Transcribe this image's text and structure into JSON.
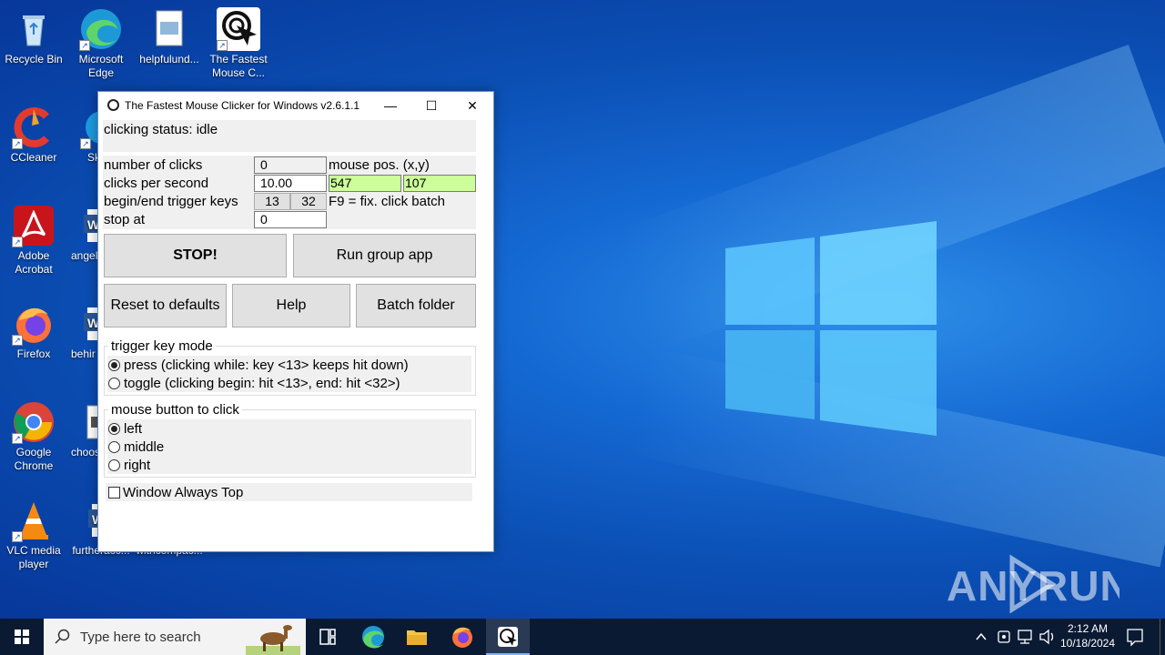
{
  "desktop": {
    "icons": [
      {
        "label": "Recycle Bin",
        "icon": "recycle-bin-icon"
      },
      {
        "label": "Microsoft Edge",
        "icon": "edge-icon"
      },
      {
        "label": "helpfulund...",
        "icon": "image-file-icon"
      },
      {
        "label": "The Fastest Mouse C...",
        "icon": "mouse-clicker-icon"
      },
      {
        "label": "CCleaner",
        "icon": "ccleaner-icon"
      },
      {
        "label": "Sk",
        "icon": "skype-icon"
      },
      {
        "label": "Adobe Acrobat",
        "icon": "acrobat-icon"
      },
      {
        "label": "angel",
        "icon": "word-doc-icon"
      },
      {
        "label": "Firefox",
        "icon": "firefox-icon"
      },
      {
        "label": "behir",
        "icon": "word-doc-icon"
      },
      {
        "label": "Google Chrome",
        "icon": "chrome-icon"
      },
      {
        "label": "choos",
        "icon": "file-icon"
      },
      {
        "label": "VLC media player",
        "icon": "vlc-icon"
      },
      {
        "label": "furtheracc...",
        "icon": "word-doc-icon"
      },
      {
        "label": "withcompac...",
        "icon": "word-doc-icon"
      }
    ]
  },
  "window": {
    "title": "The Fastest Mouse Clicker for Windows v2.6.1.1",
    "minimize": "—",
    "maximize": "☐",
    "close": "✕",
    "status": "clicking status: idle",
    "number_of_clicks_label": "number of clicks",
    "number_of_clicks_value": "0",
    "mouse_pos_label": "mouse pos. (x,y)",
    "clicks_per_second_label": "clicks per second",
    "clicks_per_second_value": "10.00",
    "mouse_x": "547",
    "mouse_y": "107",
    "trigger_keys_label": "begin/end trigger keys",
    "trigger_begin": "13",
    "trigger_end": "32",
    "f9_hint": "F9 = fix. click batch",
    "stop_at_label": "stop at",
    "stop_at_value": "0",
    "buttons": {
      "stop": "STOP!",
      "run_group": "Run group app",
      "reset": "Reset to defaults",
      "help": "Help",
      "batch_folder": "Batch folder"
    },
    "trigger_mode": {
      "legend": "trigger key mode",
      "options": [
        {
          "label": "press (clicking while: key <13> keeps hit down)",
          "selected": true
        },
        {
          "label": "toggle (clicking begin: hit <13>, end: hit <32>)",
          "selected": false
        }
      ]
    },
    "mouse_button": {
      "legend": "mouse button to click",
      "options": [
        {
          "label": "left",
          "selected": true
        },
        {
          "label": "middle",
          "selected": false
        },
        {
          "label": "right",
          "selected": false
        }
      ]
    },
    "always_top": {
      "label": "Window Always Top",
      "checked": false
    }
  },
  "taskbar": {
    "search_placeholder": "Type here to search",
    "time": "2:12 AM",
    "date": "10/18/2024"
  },
  "watermark": "ANY RUN"
}
